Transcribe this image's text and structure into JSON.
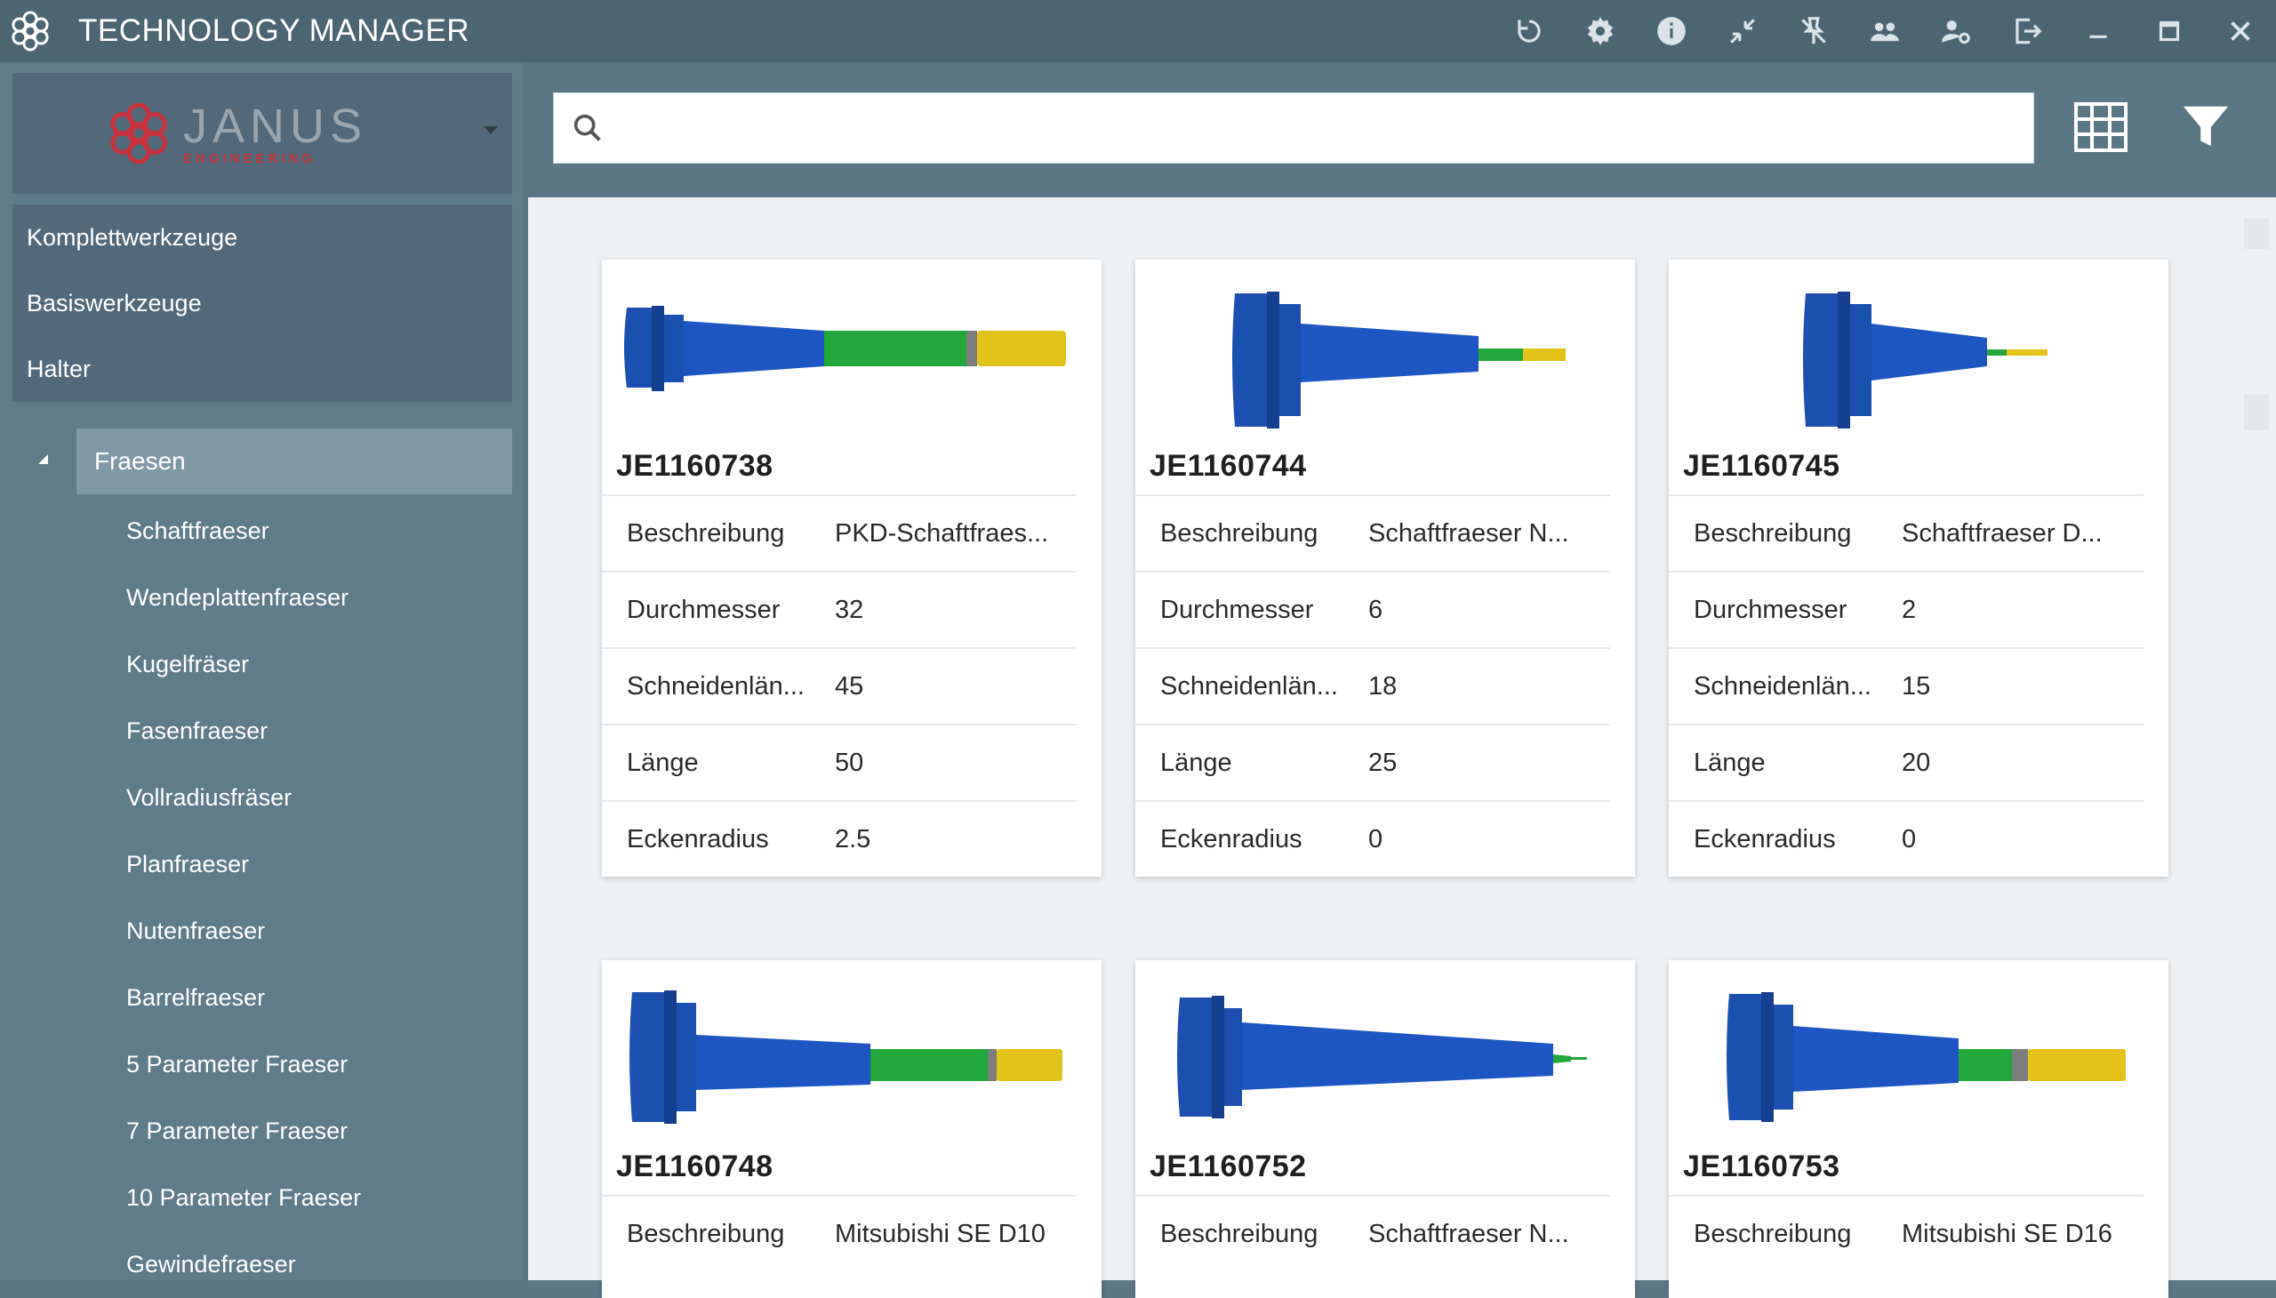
{
  "window": {
    "title": "TECHNOLOGY MANAGER",
    "toolbar_icons": [
      "refresh-icon",
      "settings-icon",
      "info-icon",
      "collapse-icon",
      "unpin-icon",
      "users-icon",
      "user-settings-icon",
      "logout-icon",
      "minimize-icon",
      "maximize-icon",
      "close-icon"
    ]
  },
  "brand": {
    "name": "JANUS",
    "subtitle": "ENGINEERING",
    "accent": "#c7333c"
  },
  "sidebar": {
    "top_categories": [
      "Komplettwerkzeuge",
      "Basiswerkzeuge",
      "Halter"
    ],
    "selected": "Fraesen",
    "children": [
      "Schaftfraeser",
      "Wendeplattenfraeser",
      "Kugelfräser",
      "Fasenfraeser",
      "Vollradiusfräser",
      "Planfraeser",
      "Nutenfraeser",
      "Barrelfraeser",
      "5 Parameter Fraeser",
      "7 Parameter Fraeser",
      "10 Parameter Fraeser",
      "Gewindefraeser"
    ]
  },
  "search": {
    "value": "",
    "placeholder": ""
  },
  "cards": [
    {
      "id": "JE1160738",
      "rows": [
        {
          "k": "Beschreibung",
          "v": "PKD-Schaftfraes..."
        },
        {
          "k": "Durchmesser",
          "v": "32"
        },
        {
          "k": "Schneidenlän...",
          "v": "45"
        },
        {
          "k": "Länge",
          "v": "50"
        },
        {
          "k": "Eckenradius",
          "v": "2.5"
        }
      ]
    },
    {
      "id": "JE1160744",
      "rows": [
        {
          "k": "Beschreibung",
          "v": "Schaftfraeser N..."
        },
        {
          "k": "Durchmesser",
          "v": "6"
        },
        {
          "k": "Schneidenlän...",
          "v": "18"
        },
        {
          "k": "Länge",
          "v": "25"
        },
        {
          "k": "Eckenradius",
          "v": "0"
        }
      ]
    },
    {
      "id": "JE1160745",
      "rows": [
        {
          "k": "Beschreibung",
          "v": "Schaftfraeser D..."
        },
        {
          "k": "Durchmesser",
          "v": "2"
        },
        {
          "k": "Schneidenlän...",
          "v": "15"
        },
        {
          "k": "Länge",
          "v": "20"
        },
        {
          "k": "Eckenradius",
          "v": "0"
        }
      ]
    },
    {
      "id": "JE1160748",
      "rows": [
        {
          "k": "Beschreibung",
          "v": "Mitsubishi SE D10"
        }
      ]
    },
    {
      "id": "JE1160752",
      "rows": [
        {
          "k": "Beschreibung",
          "v": "Schaftfraeser N..."
        }
      ]
    },
    {
      "id": "JE1160753",
      "rows": [
        {
          "k": "Beschreibung",
          "v": "Mitsubishi SE D16"
        }
      ]
    }
  ],
  "colors": {
    "holder_blue": "#1b4fb0",
    "shank_green": "#22a83a",
    "tip_yellow": "#e3c21a",
    "titlebar": "#4b6573",
    "selected_item": "#7f99a6"
  }
}
